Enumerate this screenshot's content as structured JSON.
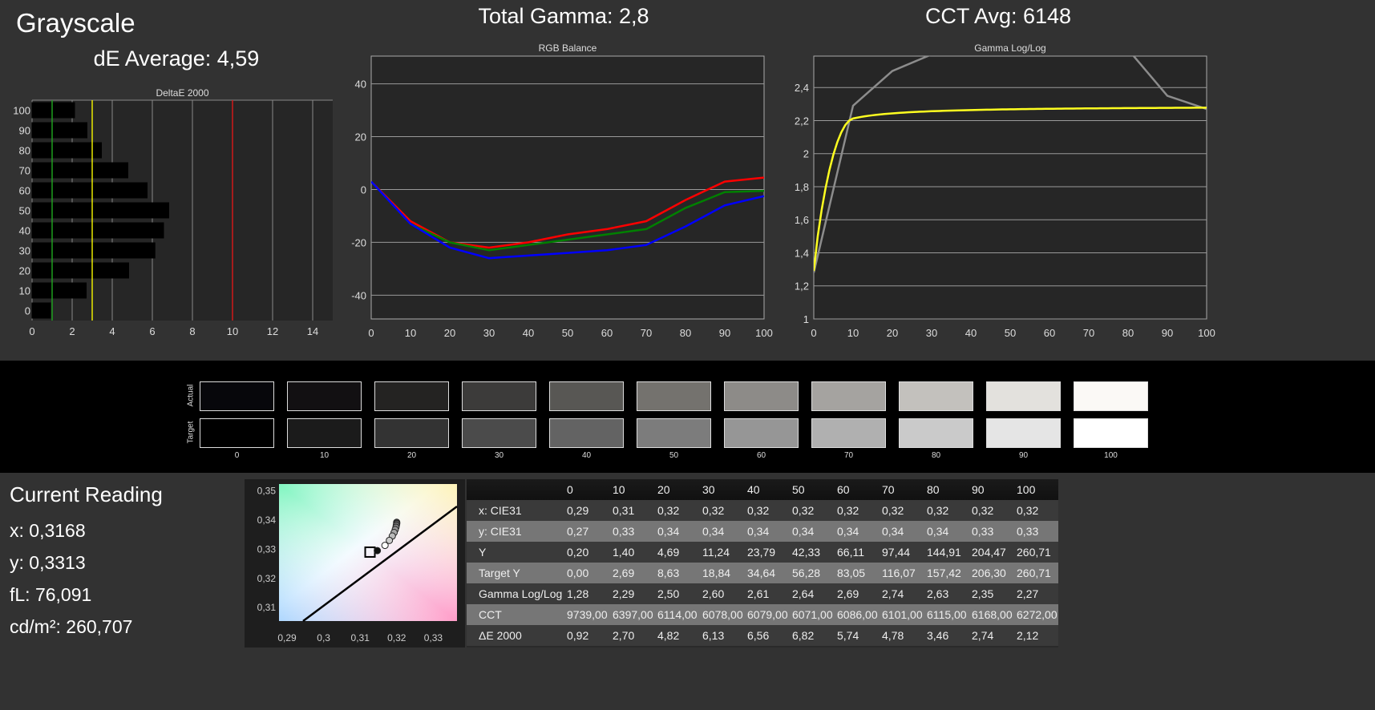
{
  "title": "Grayscale",
  "de_average": "dE Average: 4,59",
  "total_gamma": "Total Gamma: 2,8",
  "cct_avg": "CCT Avg: 6148",
  "chart_data": [
    {
      "type": "bar",
      "orientation": "horizontal",
      "title": "DeltaE 2000",
      "categories": [
        "0",
        "10",
        "20",
        "30",
        "40",
        "50",
        "60",
        "70",
        "80",
        "90",
        "100"
      ],
      "values": [
        0.92,
        2.7,
        4.82,
        6.13,
        6.56,
        6.82,
        5.74,
        4.78,
        3.46,
        2.74,
        2.12
      ],
      "xlim": [
        0,
        15
      ],
      "xticks": [
        "0",
        "2",
        "4",
        "6",
        "8",
        "10",
        "12",
        "14"
      ],
      "reference_lines": [
        {
          "value": 1,
          "color": "#1e9e1e"
        },
        {
          "value": 3,
          "color": "#e8e800"
        },
        {
          "value": 10,
          "color": "#d01818"
        }
      ],
      "grid": true
    },
    {
      "type": "line",
      "title": "RGB Balance",
      "x": [
        0,
        10,
        20,
        30,
        40,
        50,
        60,
        70,
        80,
        90,
        100
      ],
      "xticks": [
        "0",
        "10",
        "20",
        "30",
        "40",
        "50",
        "60",
        "70",
        "80",
        "90",
        "100"
      ],
      "yticks": [
        "40",
        "20",
        "0",
        "-20",
        "-40"
      ],
      "ylim": [
        -49,
        50.5
      ],
      "grid": true,
      "series": [
        {
          "color": "#ff0000",
          "values": [
            3,
            -12,
            -20,
            -22,
            -20,
            -17,
            -15,
            -12,
            -4,
            3,
            4.5
          ]
        },
        {
          "color": "#008000",
          "values": [
            3,
            -13,
            -20,
            -23,
            -21,
            -19,
            -17,
            -15,
            -7,
            -1,
            -0.5
          ]
        },
        {
          "color": "#0000ff",
          "values": [
            3,
            -13,
            -22,
            -26,
            -25,
            -24,
            -23,
            -21,
            -14,
            -6,
            -2.5
          ]
        }
      ]
    },
    {
      "type": "line",
      "title": "Gamma Log/Log",
      "x": [
        0,
        10,
        20,
        30,
        40,
        50,
        60,
        70,
        80,
        90,
        100
      ],
      "xticks": [
        "0",
        "10",
        "20",
        "30",
        "40",
        "50",
        "60",
        "70",
        "80",
        "90",
        "100"
      ],
      "yticks": [
        "2,4",
        "2,2",
        "2",
        "1,8",
        "1,6",
        "1,4",
        "1,2",
        "1"
      ],
      "ylim": [
        1,
        2.59
      ],
      "grid": true,
      "series": [
        {
          "color": "#8c8c8c",
          "values": [
            1.28,
            2.29,
            2.5,
            2.6,
            2.61,
            2.64,
            2.69,
            2.74,
            2.63,
            2.35,
            2.27
          ]
        },
        {
          "color": "#ffff20",
          "values": [
            1.29,
            2.0,
            2.13,
            2.18,
            2.21,
            2.23,
            2.245,
            2.255,
            2.265,
            2.275,
            2.285
          ]
        }
      ]
    },
    {
      "type": "scatter",
      "title": "",
      "xticks": [
        "0,29",
        "0,3",
        "0,31",
        "0,32",
        "0,33"
      ],
      "yticks": [
        "0,35",
        "0,34",
        "0,33",
        "0,32",
        "0,31"
      ],
      "xlim": [
        0.2878,
        0.3365
      ],
      "ylim": [
        0.3054,
        0.3523
      ],
      "target": {
        "x": 0.3127,
        "y": 0.329
      },
      "points": [
        {
          "x": 0.3147,
          "y": 0.3295
        },
        {
          "x": 0.3168,
          "y": 0.3313
        },
        {
          "x": 0.318,
          "y": 0.333
        },
        {
          "x": 0.3188,
          "y": 0.3345
        },
        {
          "x": 0.3193,
          "y": 0.3357
        },
        {
          "x": 0.3196,
          "y": 0.3367
        },
        {
          "x": 0.3198,
          "y": 0.3375
        },
        {
          "x": 0.3199,
          "y": 0.3382
        },
        {
          "x": 0.32,
          "y": 0.3388
        },
        {
          "x": 0.32,
          "y": 0.3392
        }
      ]
    }
  ],
  "swatches": {
    "actual_label": "Actual",
    "target_label": "Target",
    "labels": [
      "0",
      "10",
      "20",
      "30",
      "40",
      "50",
      "60",
      "70",
      "80",
      "90",
      "100"
    ],
    "actual": [
      "#07070b",
      "#121012",
      "#242322",
      "#3c3b3a",
      "#585754",
      "#74726e",
      "#8d8b88",
      "#a5a3a0",
      "#c3c1bd",
      "#e3e1dd",
      "#fbf9f6"
    ],
    "target": [
      "#000000",
      "#1b1b1b",
      "#333333",
      "#4b4b4b",
      "#636363",
      "#7c7c7c",
      "#969696",
      "#b0b0b0",
      "#cacaca",
      "#e5e5e5",
      "#ffffff"
    ]
  },
  "current_reading": {
    "title": "Current Reading",
    "x": "x: 0,3168",
    "y": "y: 0,3313",
    "fl": "fL: 76,091",
    "cdm2": "cd/m²: 260,707"
  },
  "table": {
    "headers": [
      "",
      "0",
      "10",
      "20",
      "30",
      "40",
      "50",
      "60",
      "70",
      "80",
      "90",
      "100"
    ],
    "rows": [
      [
        "x: CIE31",
        "0,29",
        "0,31",
        "0,32",
        "0,32",
        "0,32",
        "0,32",
        "0,32",
        "0,32",
        "0,32",
        "0,32",
        "0,32"
      ],
      [
        "y: CIE31",
        "0,27",
        "0,33",
        "0,34",
        "0,34",
        "0,34",
        "0,34",
        "0,34",
        "0,34",
        "0,34",
        "0,33",
        "0,33"
      ],
      [
        "Y",
        "0,20",
        "1,40",
        "4,69",
        "11,24",
        "23,79",
        "42,33",
        "66,11",
        "97,44",
        "144,91",
        "204,47",
        "260,71"
      ],
      [
        "Target Y",
        "0,00",
        "2,69",
        "8,63",
        "18,84",
        "34,64",
        "56,28",
        "83,05",
        "116,07",
        "157,42",
        "206,30",
        "260,71"
      ],
      [
        "Gamma Log/Log",
        "1,28",
        "2,29",
        "2,50",
        "2,60",
        "2,61",
        "2,64",
        "2,69",
        "2,74",
        "2,63",
        "2,35",
        "2,27"
      ],
      [
        "CCT",
        "9739,00",
        "6397,00",
        "6114,00",
        "6078,00",
        "6079,00",
        "6071,00",
        "6086,00",
        "6101,00",
        "6115,00",
        "6168,00",
        "6272,00"
      ],
      [
        "ΔE 2000",
        "0,92",
        "2,70",
        "4,82",
        "6,13",
        "6,56",
        "6,82",
        "5,74",
        "4,78",
        "3,46",
        "2,74",
        "2,12"
      ]
    ]
  }
}
